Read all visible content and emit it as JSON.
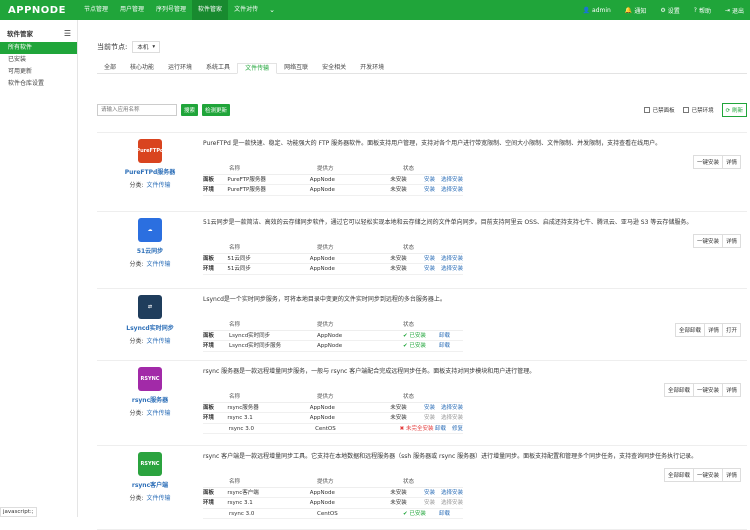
{
  "logo": "APPNODE",
  "topnav": [
    "节点管理",
    "用户管理",
    "序列号管理",
    "软件管家",
    "文件对传"
  ],
  "topnav_active": 3,
  "topright": {
    "user": "admin",
    "notify": "通知",
    "settings": "设置",
    "help": "帮助",
    "logout": "退出"
  },
  "sidebar": {
    "title": "软件管家",
    "items": [
      "所有软件",
      "已安装",
      "可用更新",
      "软件仓库设置"
    ],
    "active": 0
  },
  "node": {
    "label": "当前节点:",
    "value": "本机"
  },
  "tabs": [
    "全部",
    "核心功能",
    "运行环境",
    "系统工具",
    "文件传输",
    "网络互联",
    "安全相关",
    "开发环境"
  ],
  "tab_active": 4,
  "search": {
    "placeholder": "请输入应用名称",
    "search_btn": "搜索",
    "check_btn": "检测更新",
    "cb1": "已禁面板",
    "cb2": "已禁环境",
    "refresh": "刷新"
  },
  "table_head": {
    "name": "名称",
    "provider": "提供方",
    "status": "状态"
  },
  "cat_label": "分类:",
  "apps": [
    {
      "name": "PureFTPd服务器",
      "category": "文件传输",
      "logo_text": "PureFTPd",
      "logo_color": "#d9441f",
      "desc": "PureFTPd 是一款快速、稳定、功能强大的 FTP 服务器软件。面板支持用户管理，支持对各个用户进行带宽限制、空间大小限制、文件限制、并发限制，支持查看在线用户。",
      "actions": [
        "一键安装",
        "详情"
      ],
      "rows": [
        {
          "type": "面板",
          "name": "PureFTP服务器",
          "provider": "AppNode",
          "status": "未安装",
          "links": [
            "安装",
            "选择安装"
          ],
          "status_cls": ""
        },
        {
          "type": "环境",
          "name": "PureFTP服务器",
          "provider": "AppNode",
          "status": "未安装",
          "links": [
            "安装",
            "选择安装"
          ],
          "status_cls": ""
        }
      ]
    },
    {
      "name": "51云同步",
      "category": "文件传输",
      "logo_text": "☁",
      "logo_color": "#2b6fe0",
      "desc": "51云同步是一款简洁、高效的云存储同步软件，通过它可以轻松实现本地和云存储之间的文件单向同步。目前支持阿里云 OSS、启成还持支持七牛、腾讯云、亚马逊 S3 等云存储服务。",
      "actions": [
        "一键安装",
        "详情"
      ],
      "rows": [
        {
          "type": "面板",
          "name": "51云同步",
          "provider": "AppNode",
          "status": "未安装",
          "links": [
            "安装",
            "选择安装"
          ],
          "status_cls": ""
        },
        {
          "type": "环境",
          "name": "51云同步",
          "provider": "AppNode",
          "status": "未安装",
          "links": [
            "安装",
            "选择安装"
          ],
          "status_cls": ""
        }
      ]
    },
    {
      "name": "Lsyncd实时同步",
      "category": "文件传输",
      "logo_text": "⇄",
      "logo_color": "#1f3d5c",
      "desc": "Lsyncd是一个实时同步服务，可将本地目录中变更的文件实时同步到远程的多台服务器上。",
      "actions": [
        "全部卸载",
        "详情",
        "打开"
      ],
      "rows": [
        {
          "type": "面板",
          "name": "Lsyncd实时同步",
          "provider": "AppNode",
          "status": "✔ 已安装",
          "links": [
            "卸载"
          ],
          "status_cls": "ok"
        },
        {
          "type": "环境",
          "name": "Lsyncd实时同步服务",
          "provider": "AppNode",
          "status": "✔ 已安装",
          "links": [
            "卸载"
          ],
          "status_cls": "ok"
        }
      ]
    },
    {
      "name": "rsync服务器",
      "category": "文件传输",
      "logo_text": "RSYNC",
      "logo_color": "#a22aa8",
      "desc": "rsync 服务器是一款远程增量同步服务，一般与 rsync 客户端配合完成远程同步任务。面板支持对同步模块和用户进行管理。",
      "actions": [
        "全部卸载",
        "一键安装",
        "详情"
      ],
      "rows": [
        {
          "type": "面板",
          "name": "rsync服务器",
          "provider": "AppNode",
          "status": "未安装",
          "links": [
            "安装",
            "选择安装"
          ],
          "status_cls": ""
        },
        {
          "type": "环境",
          "name": "rsync 3.1",
          "provider": "AppNode",
          "status": "未安装",
          "links": [
            "安装",
            "选择安装"
          ],
          "status_cls": "",
          "dim": true
        },
        {
          "type": "",
          "name": "rsync 3.0",
          "provider": "CentOS",
          "status": "✖ 未完全安装",
          "links": [
            "卸载",
            "修复"
          ],
          "status_cls": "warn"
        }
      ]
    },
    {
      "name": "rsync客户端",
      "category": "文件传输",
      "logo_text": "RSYNC",
      "logo_color": "#2ba33f",
      "desc": "rsync 客户端是一款远程增量同步工具。它支持在本地数据和远程服务器（ssh 服务器或 rsync 服务器）进行增量同步。面板支持配置和管理多个同步任务，支持查询同步任务执行记录。",
      "actions": [
        "全部卸载",
        "一键安装",
        "详情"
      ],
      "rows": [
        {
          "type": "面板",
          "name": "rsync客户端",
          "provider": "AppNode",
          "status": "未安装",
          "links": [
            "安装",
            "选择安装"
          ],
          "status_cls": ""
        },
        {
          "type": "环境",
          "name": "rsync 3.1",
          "provider": "AppNode",
          "status": "未安装",
          "links": [
            "安装",
            "选择安装"
          ],
          "status_cls": "",
          "dim": true
        },
        {
          "type": "",
          "name": "rsync 3.0",
          "provider": "CentOS",
          "status": "✔ 已安装",
          "links": [
            "卸载"
          ],
          "status_cls": "ok"
        }
      ]
    }
  ],
  "tooltip": "javascript:;"
}
